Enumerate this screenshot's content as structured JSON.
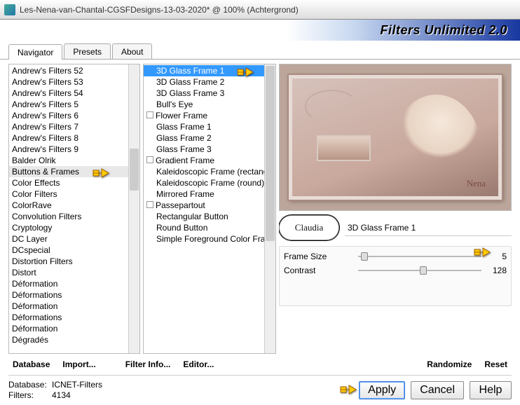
{
  "window": {
    "title": "Les-Nena-van-Chantal-CGSFDesigns-13-03-2020* @ 100% (Achtergrond)"
  },
  "brand": "Filters Unlimited 2.0",
  "tabs": [
    "Navigator",
    "Presets",
    "About"
  ],
  "activeTab": 0,
  "categories": [
    "Andrew's Filters 52",
    "Andrew's Filters 53",
    "Andrew's Filters 54",
    "Andrew's Filters 5",
    "Andrew's Filters 6",
    "Andrew's Filters 7",
    "Andrew's Filters 8",
    "Andrew's Filters 9",
    "Balder Olrik",
    "Buttons & Frames",
    "Color Effects",
    "Color Filters",
    "ColorRave",
    "Convolution Filters",
    "Cryptology",
    "DC Layer",
    "DCspecial",
    "Distortion Filters",
    "Distort",
    "Déformation",
    "Déformations",
    "Déformation",
    "Déformations",
    "Déformation",
    "Dégradés"
  ],
  "categoryHighlight": 9,
  "filters": [
    {
      "n": "3D Glass Frame 1",
      "sel": true
    },
    {
      "n": "3D Glass Frame 2"
    },
    {
      "n": "3D Glass Frame 3"
    },
    {
      "n": "Bull's Eye"
    },
    {
      "n": "Flower Frame",
      "g": true
    },
    {
      "n": "Glass Frame 1"
    },
    {
      "n": "Glass Frame 2"
    },
    {
      "n": "Glass Frame 3"
    },
    {
      "n": "Gradient Frame",
      "g": true
    },
    {
      "n": "Kaleidoscopic Frame (rectangular)"
    },
    {
      "n": "Kaleidoscopic Frame (round)"
    },
    {
      "n": "Mirrored Frame"
    },
    {
      "n": "Passepartout",
      "g": true
    },
    {
      "n": "Rectangular Button"
    },
    {
      "n": "Round Button"
    },
    {
      "n": "Simple Foreground Color Frame"
    }
  ],
  "badge": "Claudia",
  "signature": "Nena",
  "current_filter": "3D Glass Frame 1",
  "sliders": [
    {
      "label": "Frame Size",
      "value": 5,
      "pos": 2
    },
    {
      "label": "Contrast",
      "value": 128,
      "pos": 50
    }
  ],
  "buttons_left": [
    "Database",
    "Import..."
  ],
  "buttons_mid": [
    "Filter Info...",
    "Editor..."
  ],
  "buttons_right": [
    "Randomize",
    "Reset"
  ],
  "bottom_buttons": [
    "Apply",
    "Cancel",
    "Help"
  ],
  "status": {
    "db_label": "Database:",
    "db": "ICNET-Filters",
    "flt_label": "Filters:",
    "flt": "4134"
  }
}
